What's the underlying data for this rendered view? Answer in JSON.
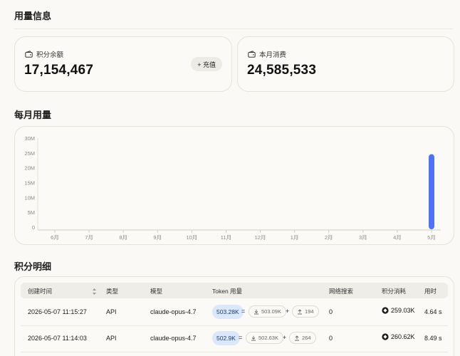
{
  "usage_title": "用量信息",
  "cards": {
    "balance": {
      "label": "积分余额",
      "value": "17,154,467",
      "recharge_label": "+ 充值"
    },
    "monthly": {
      "label": "本月消费",
      "value": "24,585,533"
    }
  },
  "monthly_title": "每月用量",
  "chart_data": {
    "type": "bar",
    "categories": [
      "6月",
      "7月",
      "8月",
      "9月",
      "10月",
      "11月",
      "12月",
      "1月",
      "2月",
      "3月",
      "4月",
      "5月"
    ],
    "values": [
      0,
      0,
      0,
      0,
      0,
      0,
      0,
      0,
      0,
      0,
      0,
      24585533
    ],
    "yticks": [
      "0",
      "5M",
      "10M",
      "15M",
      "20M",
      "25M",
      "30M"
    ],
    "ylim": [
      0,
      30000000
    ],
    "color": "#4f74f0",
    "grid": false
  },
  "ledger_title": "积分明细",
  "table": {
    "headers": [
      "创建时间",
      "类型",
      "模型",
      "Token 用量",
      "网络搜索",
      "积分消耗",
      "用时"
    ],
    "rows": [
      {
        "time": "2026-05-07 11:15:27",
        "type": "API",
        "model": "claude-opus-4.7",
        "token_total": "503.28K",
        "eq": "=",
        "input": "503.09K",
        "plus": "+",
        "output": "194",
        "search": "0",
        "cost": "259.03K",
        "duration": "4.64 s"
      },
      {
        "time": "2026-05-07 11:14:03",
        "type": "API",
        "model": "claude-opus-4.7",
        "token_total": "502.9K",
        "eq": "=",
        "input": "502.63K",
        "plus": "+",
        "output": "264",
        "search": "0",
        "cost": "260.62K",
        "duration": "8.49 s"
      }
    ]
  }
}
